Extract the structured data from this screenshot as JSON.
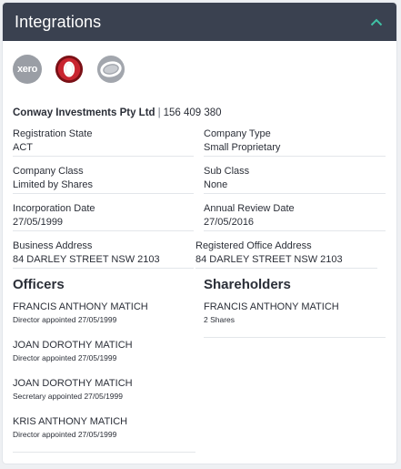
{
  "header": {
    "title": "Integrations"
  },
  "logos": [
    {
      "name": "xero-logo",
      "text": "xero"
    },
    {
      "name": "red-ring-logo",
      "text": ""
    },
    {
      "name": "grey-ring-logo",
      "text": ""
    }
  ],
  "company": {
    "name": "Conway Investments Pty Ltd",
    "separator": "|",
    "number": "156 409 380"
  },
  "fields": {
    "registration_state": {
      "label": "Registration State",
      "value": "ACT"
    },
    "company_type": {
      "label": "Company Type",
      "value": "Small Proprietary"
    },
    "company_class": {
      "label": "Company Class",
      "value": "Limited by Shares"
    },
    "sub_class": {
      "label": "Sub Class",
      "value": "None"
    },
    "incorporation_date": {
      "label": "Incorporation Date",
      "value": "27/05/1999"
    },
    "annual_review_date": {
      "label": "Annual Review Date",
      "value": "27/05/2016"
    },
    "business_address": {
      "label": "Business Address",
      "value": "84 DARLEY STREET NSW 2103"
    },
    "registered_office_address": {
      "label": "Registered Office Address",
      "value": "84 DARLEY STREET NSW 2103"
    }
  },
  "officers": {
    "title": "Officers",
    "items": [
      {
        "name": "FRANCIS ANTHONY MATICH",
        "role": "Director appointed 27/05/1999"
      },
      {
        "name": "JOAN DOROTHY MATICH",
        "role": "Director appointed 27/05/1999"
      },
      {
        "name": "JOAN DOROTHY MATICH",
        "role": "Secretary appointed 27/05/1999"
      },
      {
        "name": "KRIS ANTHONY MATICH",
        "role": "Director appointed 27/05/1999"
      }
    ]
  },
  "shareholders": {
    "title": "Shareholders",
    "items": [
      {
        "name": "FRANCIS ANTHONY MATICH",
        "shares": "2 Shares"
      }
    ]
  },
  "colors": {
    "header_bg": "#3a4150",
    "accent": "#3fc1a5",
    "xero_logo": "#9a9ea5",
    "red_logo": "#c8242f"
  }
}
